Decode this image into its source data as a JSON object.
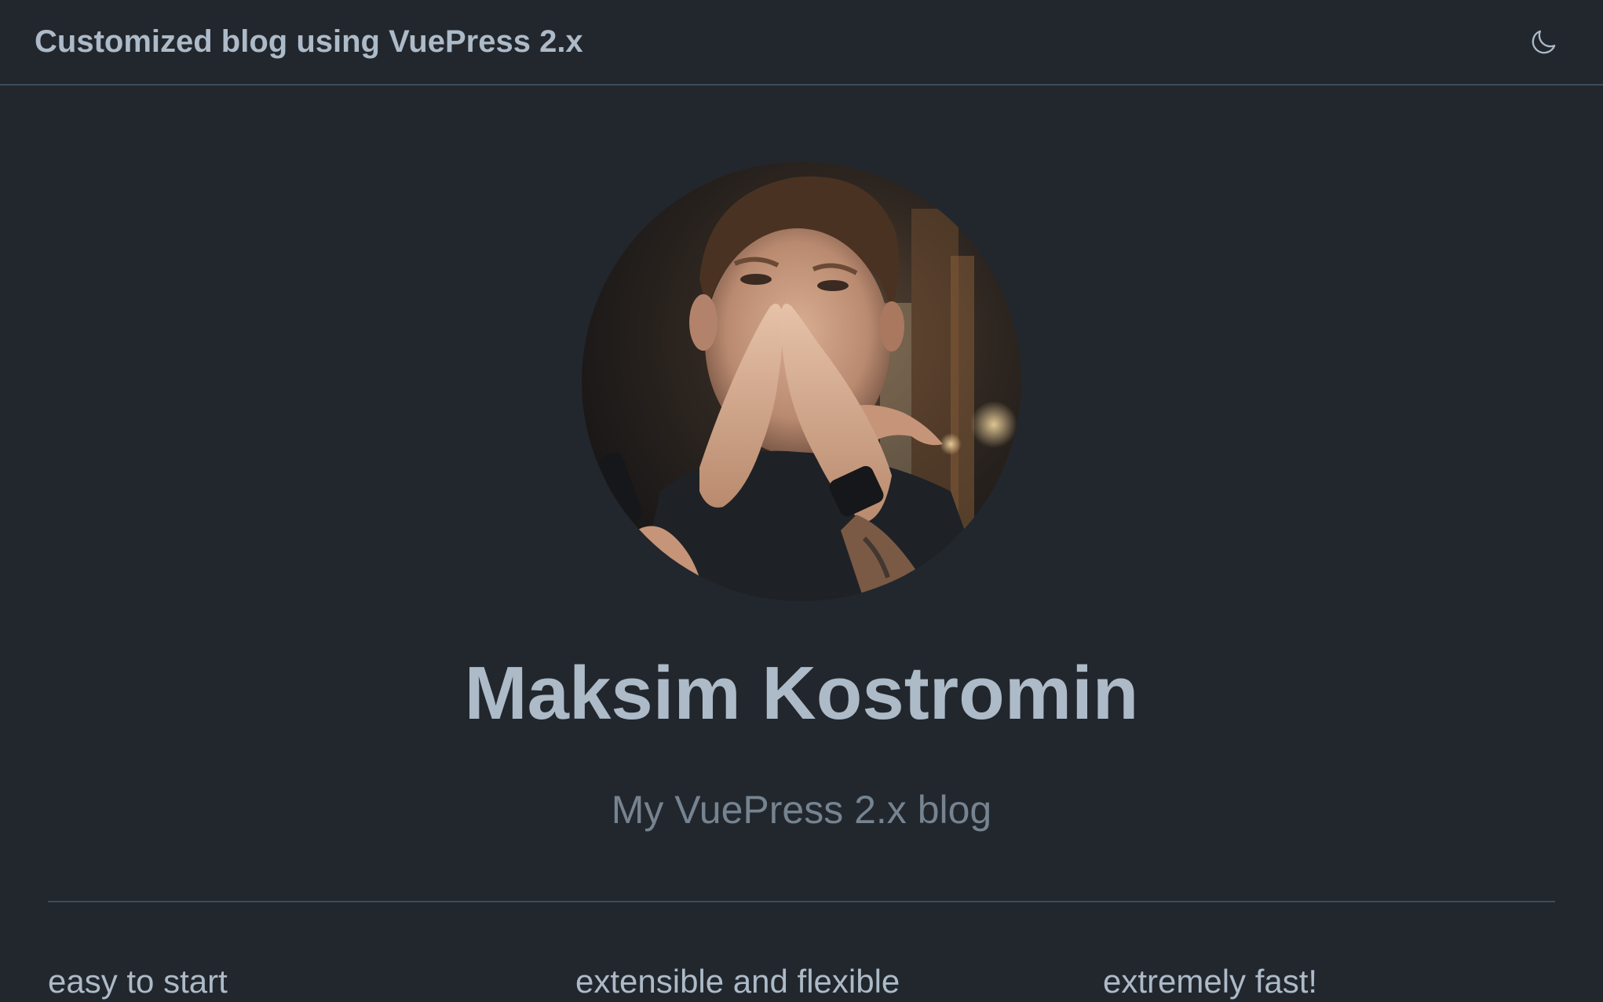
{
  "navbar": {
    "site_title": "Customized blog using VuePress 2.x",
    "theme_toggle_icon": "moon-icon"
  },
  "hero": {
    "avatar_alt": "portrait-photo",
    "name": "Maksim Kostromin",
    "description": "My VuePress 2.x blog"
  },
  "features": [
    {
      "title": "easy to start"
    },
    {
      "title": "extensible and flexible"
    },
    {
      "title": "extremely fast!"
    }
  ],
  "colors": {
    "background": "#22272e",
    "text": "#adbac7",
    "text_muted": "#768390",
    "border": "#3e4c5a"
  }
}
